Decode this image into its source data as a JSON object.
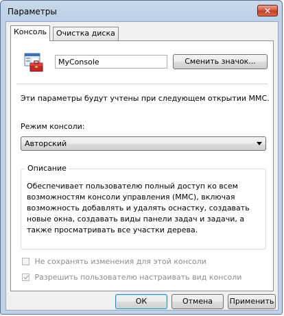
{
  "window": {
    "title": "Параметры",
    "close_glyph": "✕"
  },
  "tabs": [
    {
      "label": "Консоль",
      "active": true
    },
    {
      "label": "Очистка диска",
      "active": false
    }
  ],
  "console": {
    "name_value": "MyConsole",
    "change_icon_label": "Сменить значок...",
    "info_text": "Эти параметры будут учтены при следующем открытии MMC.",
    "mode_label": "Режим консоли:",
    "mode_selected": "Авторский",
    "description_caption": "Описание",
    "description_text": "Обеспечивает пользователю полный доступ ко всем возможностям консоли управления (MMC), включая возможность добавлять и удалять оснастку, создавать новые окна, создавать виды панели задач и задачи, а также просматривать все участки дерева.",
    "checkbox_no_save": {
      "label": "Не сохранять изменения для этой консоли",
      "checked": false,
      "enabled": false
    },
    "checkbox_allow_customize": {
      "label": "Разрешить пользователю настраивать вид консоли",
      "checked": true,
      "enabled": false
    }
  },
  "buttons": {
    "ok": "ОК",
    "cancel": "Отмена",
    "apply": "Применить"
  },
  "icons": {
    "console": "toolbox-console-icon"
  },
  "colors": {
    "title_bar": "#bfd2e7",
    "close_button": "#c8432a",
    "panel_bg": "#ffffff",
    "dialog_bg": "#f0f0f0"
  }
}
